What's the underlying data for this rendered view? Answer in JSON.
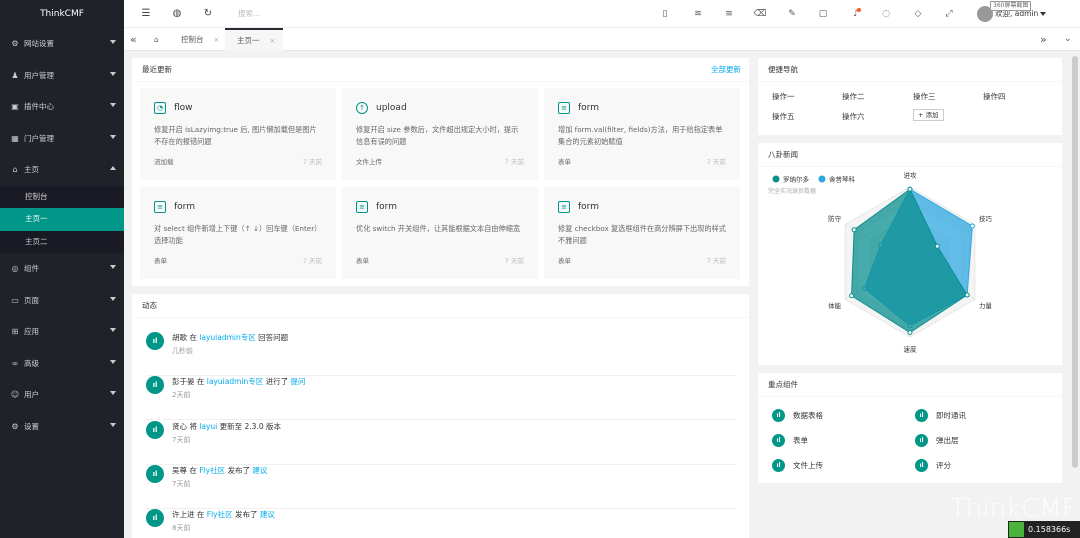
{
  "app": {
    "logo": "ThinkCMF",
    "brand_watermark": "ThinkCMF",
    "timer": "0.158366s"
  },
  "sidebar": {
    "items": [
      {
        "label": "网站设置",
        "icon": "gear-icon"
      },
      {
        "label": "用户管理",
        "icon": "users-icon"
      },
      {
        "label": "插件中心",
        "icon": "plugin-icon"
      },
      {
        "label": "门户管理",
        "icon": "grid-icon"
      },
      {
        "label": "主页",
        "icon": "home-icon",
        "expanded": true
      },
      {
        "label": "组件",
        "icon": "component-icon"
      },
      {
        "label": "页面",
        "icon": "page-icon"
      },
      {
        "label": "应用",
        "icon": "app-icon"
      },
      {
        "label": "高级",
        "icon": "senior-icon"
      },
      {
        "label": "用户",
        "icon": "user-icon"
      },
      {
        "label": "设置",
        "icon": "settings-icon"
      }
    ],
    "home_sub": [
      "控制台",
      "主页一",
      "主页二"
    ]
  },
  "header": {
    "search_placeholder": "搜索...",
    "user": "欢迎, admin",
    "screenshot_badge": "360屏幕截图"
  },
  "tabs": [
    "控制台",
    "主页一"
  ],
  "updates": {
    "title": "最近更新",
    "more": "全部更新",
    "items": [
      {
        "title": "flow",
        "desc": "修复开启 isLazyimg:true 后, 图片懒加载但是图片不存在的报错问题",
        "tag": "流加载",
        "time": "7 天前"
      },
      {
        "title": "upload",
        "desc": "修复开启 size 参数后，文件超出规定大小时，提示信息有误的问题",
        "tag": "文件上传",
        "time": "7 天前"
      },
      {
        "title": "form",
        "desc": "增加 form.val(filter, fields)方法，用于给指定表单集合的元素初始赋值",
        "tag": "表单",
        "time": "7 天前"
      },
      {
        "title": "form",
        "desc": "对 select 组件新增上下键（↑ ↓）回车键（Enter）选择功能",
        "tag": "表单",
        "time": "7 天前"
      },
      {
        "title": "form",
        "desc": "优化 switch 开关组件，让其能根据文本自由伸缩宽",
        "tag": "表单",
        "time": "7 天前"
      },
      {
        "title": "form",
        "desc": "修复 checkbox 复选框组件在高分辨屏下出现的样式不雅问题",
        "tag": "表单",
        "time": "7 天前"
      }
    ]
  },
  "dynamic": {
    "title": "动态",
    "items": [
      {
        "user": "胡歌",
        "p1": " 在 ",
        "l1": "layuiadmin专区",
        "p2": " 回答问题",
        "l2": "",
        "time": "几秒前"
      },
      {
        "user": "彭于晏",
        "p1": " 在 ",
        "l1": "layuiadmin专区",
        "p2": " 进行了 ",
        "l2": "提问",
        "time": "2天前"
      },
      {
        "user": "贤心",
        "p1": " 将 ",
        "l1": "layui",
        "p2": " 更新至 2.3.0 版本",
        "l2": "",
        "time": "7天前"
      },
      {
        "user": "吴尊",
        "p1": " 在 ",
        "l1": "Fly社区",
        "p2": " 发布了 ",
        "l2": "建议",
        "time": "7天前"
      },
      {
        "user": "许上进",
        "p1": " 在 ",
        "l1": "Fly社区",
        "p2": " 发布了 ",
        "l2": "建议",
        "time": "8天前"
      }
    ]
  },
  "quicknav": {
    "title": "便捷导航",
    "items": [
      "操作一",
      "操作二",
      "操作三",
      "操作四",
      "操作五",
      "操作六"
    ],
    "add": "+ 添加"
  },
  "gossip": {
    "title": "八卦新闻",
    "subtitle": "完全实况球员数据"
  },
  "chart_data": {
    "type": "radar",
    "indicators": [
      "进攻",
      "技巧",
      "力量",
      "速度",
      "体能",
      "防守"
    ],
    "max": 100,
    "series": [
      {
        "name": "罗纳尔多",
        "values": [
          97,
          42,
          88,
          94,
          90,
          86
        ],
        "color": "#0a8f8f"
      },
      {
        "name": "舍普琴科",
        "values": [
          97,
          96,
          88,
          85,
          70,
          45
        ],
        "color": "#2ea7e0"
      }
    ]
  },
  "key_components": {
    "title": "重点组件",
    "items": [
      "数据表格",
      "即时通讯",
      "表单",
      "弹出层",
      "文件上传",
      "评分"
    ]
  }
}
